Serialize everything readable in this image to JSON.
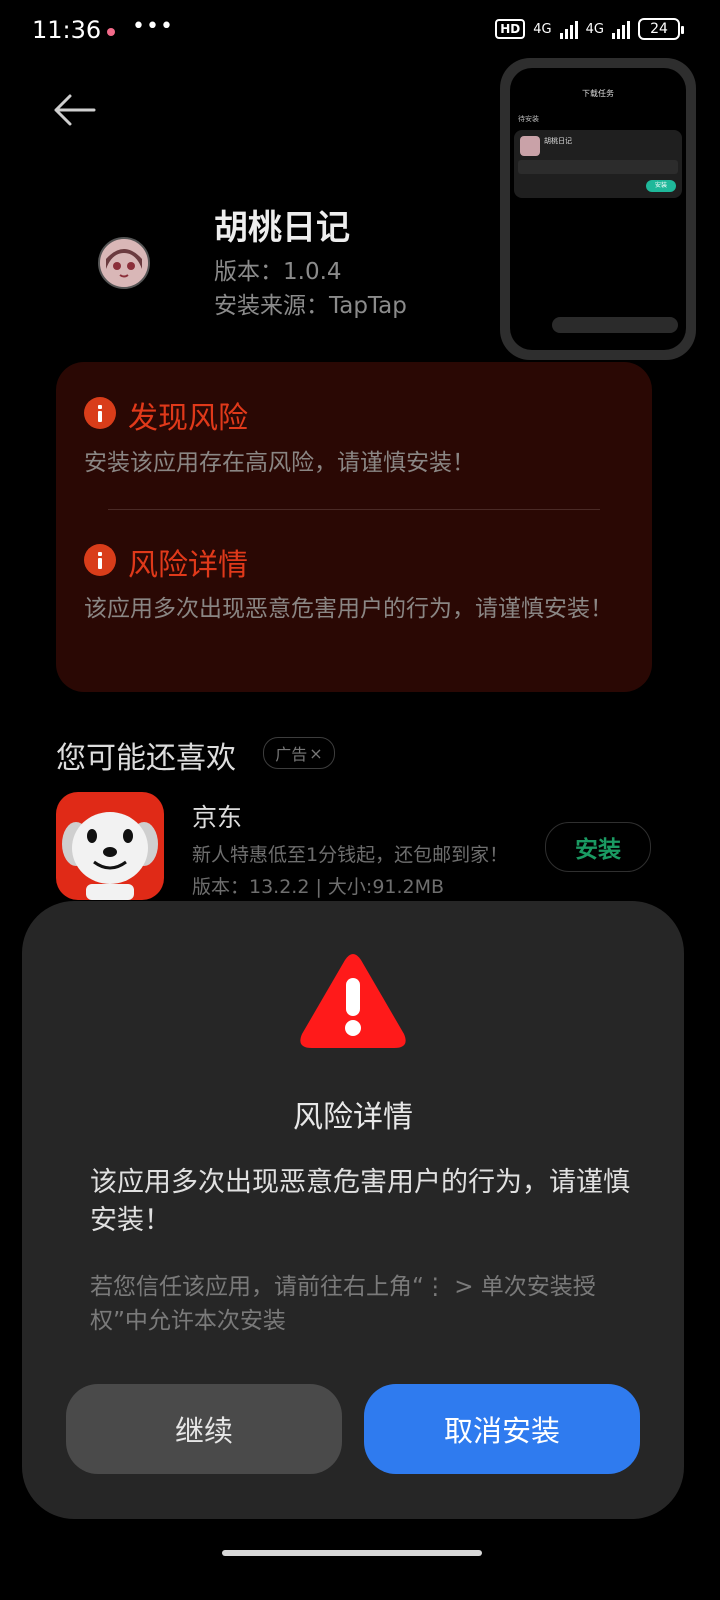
{
  "status_bar": {
    "time": "11:36",
    "more": "•••",
    "hd": "HD",
    "net1": "4G",
    "net2": "4G",
    "battery": "24"
  },
  "app": {
    "name": "胡桃日记",
    "version": "版本：1.0.4",
    "source": "安装来源：TapTap"
  },
  "preview": {
    "title": "下载任务",
    "subtitle": "待安装",
    "app_name": "胡桃日记",
    "install": "安装"
  },
  "risk": {
    "found_title": "发现风险",
    "found_text": "安装该应用存在高风险，请谨慎安装！",
    "detail_title": "风险详情",
    "detail_text": "该应用多次出现恶意危害用户的行为，请谨慎安装！"
  },
  "recommend": {
    "title": "您可能还喜欢",
    "ad_label": "广告",
    "ad_close": "×",
    "item": {
      "name": "京东",
      "desc": "新人特惠低至1分钱起，还包邮到家！",
      "meta": "版本：13.2.2 | 大小:91.2MB",
      "install": "安装"
    }
  },
  "dialog": {
    "title": "风险详情",
    "body": "该应用多次出现恶意危害用户的行为，请谨慎安装！",
    "hint": "若您信任该应用，请前往右上角“⋮ > 单次安装授权”中允许本次安装",
    "continue": "继续",
    "cancel": "取消安装"
  },
  "colors": {
    "risk_red": "#e0391a",
    "primary_blue": "#2f7bef",
    "install_green": "#1a9a62"
  }
}
